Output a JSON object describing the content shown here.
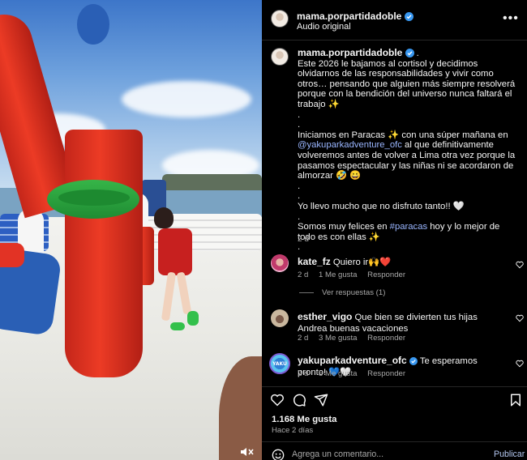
{
  "header": {
    "username": "mama.porpartidadoble",
    "audio": "Audio original",
    "more_glyph": "•••"
  },
  "caption": {
    "username": "mama.porpartidadoble",
    "first_line_tail": " .",
    "paragraph1": "Este 2026 le bajamos al cortisol y decidimos olvidarnos de las responsabilidades y vivir como otros… pensando que alguien más siempre resolverá porque con la bendición del universo nunca faltará el trabajo ✨",
    "dot": ".",
    "p2_a": "Iniciamos en Paracas ✨ con una súper mañana en ",
    "p2_link": "@yakuparkadventure_ofc",
    "p2_b": " al que definitivamente volveremos antes de volver a Lima otra vez porque la pasamos espectacular y las niñas ni se acordaron de almorzar 🤣 😀",
    "p3": "Yo llevo mucho que no disfruto tanto!! 🤍",
    "p4_a": "Somos muy felices en ",
    "p4_link": "#paracas",
    "p4_b": " hoy y lo mejor de todo es con ellas ✨",
    "time": "2 d"
  },
  "comments": [
    {
      "username": "kate_fz",
      "text": "Quiero ir🙌❤️",
      "time": "2 d",
      "likes": "1 Me gusta",
      "reply": "Responder"
    },
    {
      "username": "esther_vigo",
      "text": "Que bien se divierten tus hijas Andrea buenas vacaciones",
      "time": "2 d",
      "likes": "3 Me gusta",
      "reply": "Responder"
    },
    {
      "username": "yakuparkadventure_ofc",
      "text": "Te esperamos pronto! 💙🤍",
      "time": "2 d",
      "likes": "5 Me gusta",
      "reply": "Responder"
    }
  ],
  "replies_label": "Ver respuestas (1)",
  "yaku_avatar_text": "YAKU",
  "footer": {
    "likes": "1.168 Me gusta",
    "ago": "Hace 2 días",
    "input_placeholder": "Agrega un comentario...",
    "post_label": "Publicar"
  },
  "colors": {
    "background": "#000000",
    "link": "#9ab6ff",
    "verified": "#3897f0",
    "post_button": "#b3c7f0",
    "muted": "#a8a8a8"
  },
  "icons": [
    "verified-badge-icon",
    "heart-icon",
    "comment-icon",
    "share-icon",
    "bookmark-icon",
    "emoji-icon",
    "mute-icon",
    "more-options-icon"
  ]
}
